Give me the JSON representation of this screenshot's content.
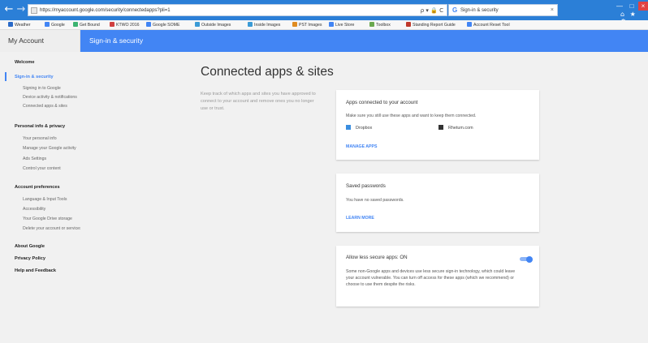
{
  "browser": {
    "url": "https://myaccount.google.com/security/connectedapps?pli=1",
    "tab_title": "Sign-in & security",
    "tab_icon": "G",
    "tab_close": "×",
    "back_glyph": "←",
    "forward_glyph": "→",
    "address_tools": "ρ ▾ 🔒 C",
    "window_controls": {
      "minimize": "—",
      "maximize": "□",
      "close": "×"
    },
    "toolbar_icons": "⌂ ★ ⚙",
    "favorites": [
      {
        "label": "Weather",
        "color": "#2a6ac8"
      },
      {
        "label": "Google",
        "color": "#4285f4"
      },
      {
        "label": "Get Bound",
        "color": "#3cb371"
      },
      {
        "label": "KTWO 2016",
        "color": "#d04040"
      },
      {
        "label": "Google SOME",
        "color": "#4285f4"
      },
      {
        "label": "Outside Images",
        "color": "#3b9bd6"
      },
      {
        "label": "Inside Images",
        "color": "#3b9bd6"
      },
      {
        "label": "PST Images",
        "color": "#e08c20"
      },
      {
        "label": "Live Store",
        "color": "#4285f4"
      },
      {
        "label": "Toolbox",
        "color": "#6aa84f"
      },
      {
        "label": "Standing Report Guide",
        "color": "#c0392b"
      },
      {
        "label": "Account Reset Tool",
        "color": "#4285f4"
      }
    ]
  },
  "header": {
    "my_account": "My Account",
    "section": "Sign-in & security"
  },
  "sidebar": {
    "welcome": "Welcome",
    "signin_security": "Sign-in & security",
    "signin_sub": [
      "Signing in to Google",
      "Device activity & notifications",
      "Connected apps & sites"
    ],
    "personal_info": "Personal info & privacy",
    "personal_sub": [
      "Your personal info",
      "Manage your Google activity",
      "Ads Settings",
      "Control your content"
    ],
    "account_prefs": "Account preferences",
    "account_sub": [
      "Language & Input Tools",
      "Accessibility",
      "Your Google Drive storage",
      "Delete your account or services"
    ],
    "about": "About Google",
    "privacy": "Privacy Policy",
    "help": "Help and Feedback"
  },
  "main": {
    "title": "Connected apps & sites",
    "intro": "Keep track of which apps and sites you have approved to connect to your account and remove ones you no longer use or trust.",
    "apps_card": {
      "title": "Apps connected to your account",
      "desc": "Make sure you still use these apps and want to keep them connected.",
      "apps": [
        {
          "name": "Dropbox",
          "color": "#3b8ee0"
        },
        {
          "name": "Rhetum.com",
          "color": "#333333"
        }
      ],
      "link": "MANAGE APPS"
    },
    "passwords_card": {
      "title": "Saved passwords",
      "desc": "You have no saved passwords.",
      "link": "LEARN MORE"
    },
    "less_secure_card": {
      "title": "Allow less secure apps: ON",
      "desc": "Some non-Google apps and devices use less secure sign-in technology, which could leave your account vulnerable. You can turn off access for these apps (which we recommend) or choose to use them despite the risks.",
      "toggle_on": true
    }
  },
  "colors": {
    "accent": "#4285f4",
    "browser_chrome": "#2b7fd7"
  }
}
